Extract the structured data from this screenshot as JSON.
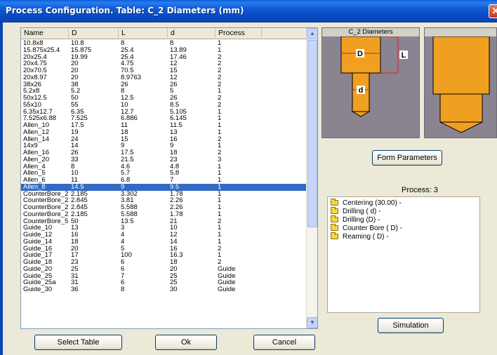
{
  "window": {
    "title": "Process Configuration. Table: C_2 Diameters (mm)"
  },
  "table": {
    "columns": [
      "Name",
      "D",
      "L",
      "d",
      "Process",
      ""
    ],
    "selected_index": 21,
    "rows": [
      [
        "10.8x8",
        "10.8",
        "8",
        "8",
        "1"
      ],
      [
        "15.875x25.4",
        "15.875",
        "25.4",
        "13.89",
        "1"
      ],
      [
        "20x25.4",
        "19.99",
        "25.4",
        "17.46",
        "2"
      ],
      [
        "20x4.75",
        "20",
        "4.75",
        "12",
        "2"
      ],
      [
        "20x70.5",
        "20",
        "70.5",
        "15",
        "2"
      ],
      [
        "20x8.97",
        "20",
        "8.9763",
        "12",
        "2"
      ],
      [
        "38x26",
        "38",
        "26",
        "26",
        "2"
      ],
      [
        "5.2x8",
        "5.2",
        "8",
        "5",
        "1"
      ],
      [
        "50x12.5",
        "50",
        "12.5",
        "26",
        "2"
      ],
      [
        "55x10",
        "55",
        "10",
        "8.5",
        "2"
      ],
      [
        "6.35x12.7",
        "6.35",
        "12.7",
        "5.105",
        "1"
      ],
      [
        "7.525x6.88",
        "7.525",
        "6.886",
        "6.145",
        "1"
      ],
      [
        "Allen_10",
        "17.5",
        "11",
        "11.5",
        "1"
      ],
      [
        "Allen_12",
        "19",
        "18",
        "13",
        "1"
      ],
      [
        "Allen_14",
        "24",
        "15",
        "16",
        "2"
      ],
      [
        "14x9",
        "14",
        "9",
        "9",
        "1"
      ],
      [
        "Allen_16",
        "26",
        "17.5",
        "18",
        "2"
      ],
      [
        "Allen_20",
        "33",
        "21.5",
        "23",
        "3"
      ],
      [
        "Allen_4",
        "8",
        "4.6",
        "4.8",
        "1"
      ],
      [
        "Allen_5",
        "10",
        "5.7",
        "5.8",
        "1"
      ],
      [
        "Allen_6",
        "11",
        "6.8",
        "7",
        "1"
      ],
      [
        "Allen_8",
        "14.5",
        "9",
        "9.5",
        "1"
      ],
      [
        "CounterBore_2...",
        "2.185",
        "3.302",
        "1.78",
        "1"
      ],
      [
        "CounterBore_2...",
        "2.845",
        "3.81",
        "2.26",
        "1"
      ],
      [
        "CounterBore_2...",
        "2.845",
        "5.588",
        "2.26",
        "1"
      ],
      [
        "CounterBore_2...",
        "2.185",
        "5.588",
        "1.78",
        "1"
      ],
      [
        "CounterBore_5...",
        "50",
        "13.5",
        "21",
        "2"
      ],
      [
        "Guide_10",
        "13",
        "3",
        "10",
        "1"
      ],
      [
        "Guide_12",
        "16",
        "4",
        "12",
        "1"
      ],
      [
        "Guide_14",
        "18",
        "4",
        "14",
        "1"
      ],
      [
        "Guide_16",
        "20",
        "5",
        "16",
        "2"
      ],
      [
        "Guide_17",
        "17",
        "100",
        "16.3",
        "1"
      ],
      [
        "Guide_18",
        "23",
        "6",
        "18",
        "2"
      ],
      [
        "Guide_20",
        "25",
        "6",
        "20",
        "Guide"
      ],
      [
        "Guide_25",
        "31",
        "7",
        "25",
        "Guide"
      ],
      [
        "Guide_25a",
        "31",
        "6",
        "25",
        "Guide"
      ],
      [
        "Guide_30",
        "36",
        "8",
        "30",
        "Guide"
      ]
    ]
  },
  "preview": {
    "title": "C_2 Diameters",
    "label_D": "D",
    "label_L": "L",
    "label_d": "d"
  },
  "buttons": {
    "form_parameters": "Form Parameters",
    "simulation": "Simulation",
    "select_table": "Select Table",
    "ok": "Ok",
    "cancel": "Cancel"
  },
  "process": {
    "label": "Process: 3",
    "items": [
      "Centering (30.00) -",
      "Drilling ( d) -",
      "Drilling (D) -",
      "Counter Bore ( D) -",
      "Reaming ( D) -"
    ]
  },
  "colors": {
    "selection": "#316ac5",
    "tool_fill": "#f0a020",
    "preview_bg": "#8a8390"
  }
}
